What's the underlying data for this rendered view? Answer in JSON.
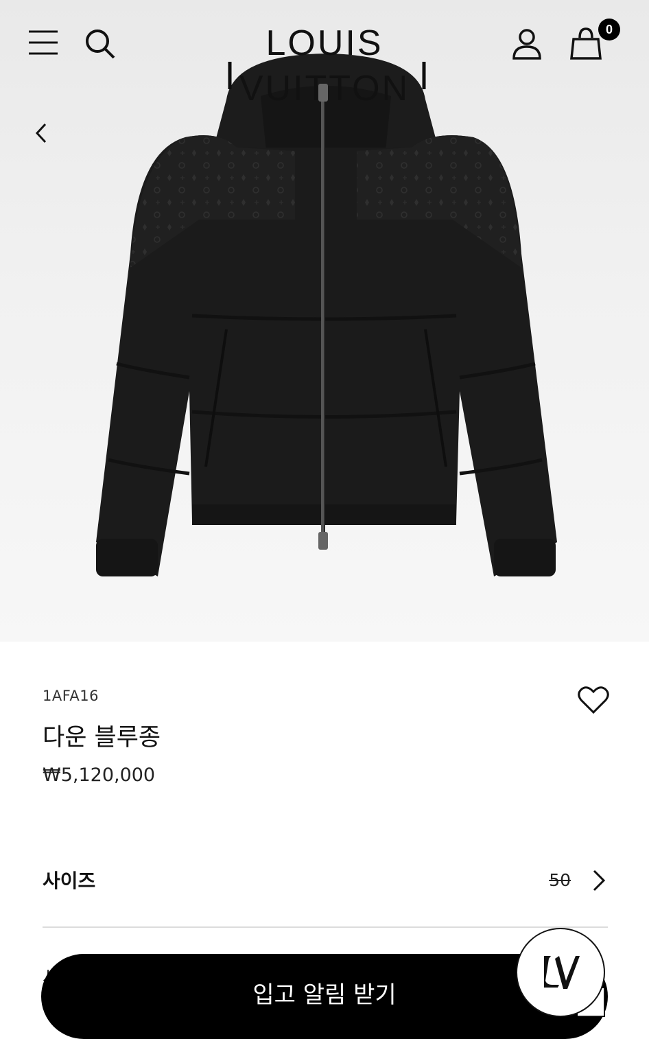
{
  "header": {
    "brand": "LOUIS VUITTON",
    "bag_count": "0"
  },
  "icons": {
    "menu": "menu-icon",
    "search": "search-icon",
    "account": "account-icon",
    "bag": "shopping-bag-icon",
    "back": "chevron-left-icon",
    "wishlist": "heart-icon",
    "size_chevron": "chevron-right-icon",
    "lv_badge": "lv-monogram-icon"
  },
  "product": {
    "sku": "1AFA16",
    "name": "다운 블루종",
    "price": "₩5,120,000"
  },
  "size": {
    "label": "사이즈",
    "value": "50"
  },
  "cta": {
    "label": "입고 알림 받기",
    "peek_text": "사"
  },
  "colors": {
    "primary": "#000000",
    "background": "#ffffff",
    "hero_background": "#efefef",
    "jacket": "#1b1b1b"
  }
}
